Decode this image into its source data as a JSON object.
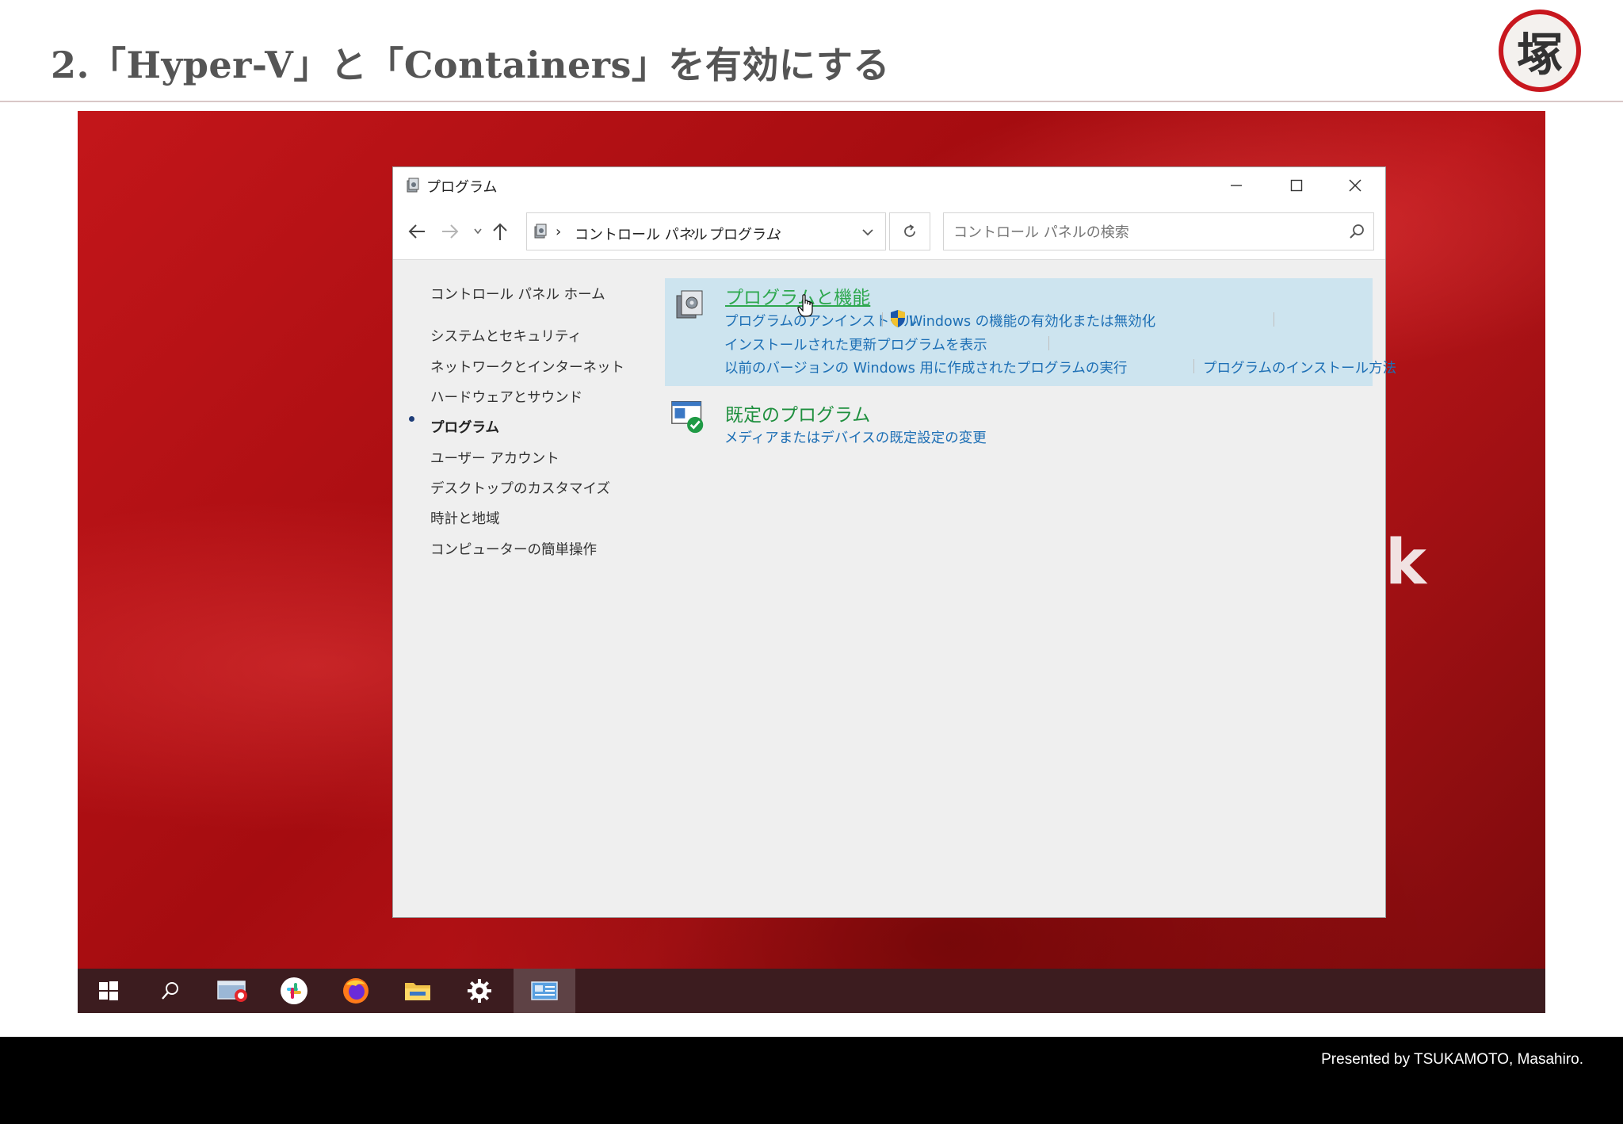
{
  "slide": {
    "title": "2.「Hyper-V」と「Containers」を有効にする",
    "logo_char": "塚",
    "footer": "Presented by TSUKAMOTO, Masahiro."
  },
  "background_text": "k",
  "window": {
    "title": "プログラム",
    "breadcrumb": [
      "コントロール パネル",
      "プログラム"
    ],
    "search_placeholder": "コントロール パネルの検索"
  },
  "sidebar": {
    "items": [
      {
        "label": "コントロール パネル ホーム",
        "current": false
      },
      {
        "label": "システムとセキュリティ",
        "current": false
      },
      {
        "label": "ネットワークとインターネット",
        "current": false
      },
      {
        "label": "ハードウェアとサウンド",
        "current": false
      },
      {
        "label": "プログラム",
        "current": true
      },
      {
        "label": "ユーザー アカウント",
        "current": false
      },
      {
        "label": "デスクトップのカスタマイズ",
        "current": false
      },
      {
        "label": "時計と地域",
        "current": false
      },
      {
        "label": "コンピューターの簡単操作",
        "current": false
      }
    ]
  },
  "categories": [
    {
      "title": "プログラムと機能",
      "tasks": [
        "プログラムのアンインストール",
        "Windows の機能の有効化または無効化",
        "インストールされた更新プログラムを表示",
        "以前のバージョンの Windows 用に作成されたプログラムの実行",
        "プログラムのインストール方法"
      ]
    },
    {
      "title": "既定のプログラム",
      "tasks": [
        "メディアまたはデバイスの既定設定の変更"
      ]
    }
  ],
  "taskbar": {
    "items": [
      "start-icon",
      "search-icon",
      "sandbox-icon",
      "slack-icon",
      "firefox-icon",
      "file-explorer-icon",
      "settings-icon",
      "control-panel-icon"
    ],
    "active": "control-panel-icon"
  },
  "colors": {
    "accent_red": "#c8171e",
    "link_blue": "#1d6fb5",
    "title_green": "#1e8f3e",
    "highlight": "#cde4ef"
  }
}
